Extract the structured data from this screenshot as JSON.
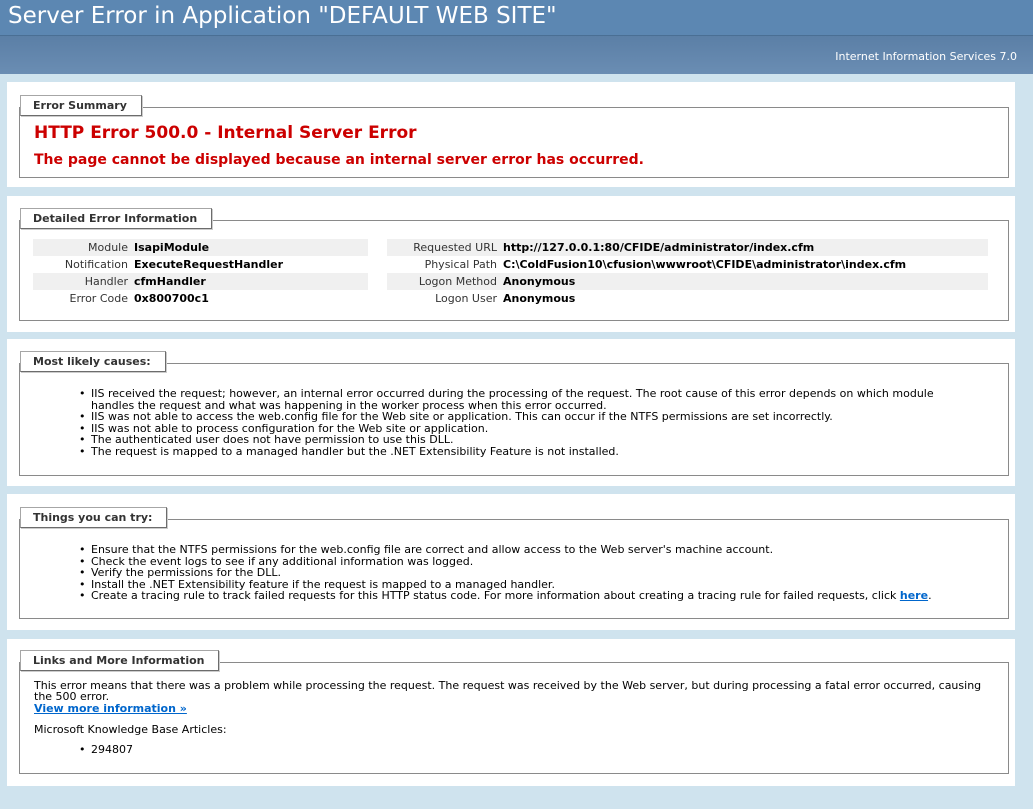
{
  "header": {
    "title": "Server Error in Application \"DEFAULT WEB SITE\"",
    "server": "Internet Information Services 7.0"
  },
  "summary": {
    "legend": "Error Summary",
    "title": "HTTP Error 500.0 - Internal Server Error",
    "message": "The page cannot be displayed because an internal server error has occurred."
  },
  "details": {
    "legend": "Detailed Error Information",
    "left": [
      {
        "label": "Module",
        "value": "IsapiModule"
      },
      {
        "label": "Notification",
        "value": "ExecuteRequestHandler"
      },
      {
        "label": "Handler",
        "value": "cfmHandler"
      },
      {
        "label": "Error Code",
        "value": "0x800700c1"
      }
    ],
    "right": [
      {
        "label": "Requested URL",
        "value": "http://127.0.0.1:80/CFIDE/administrator/index.cfm"
      },
      {
        "label": "Physical Path",
        "value": "C:\\ColdFusion10\\cfusion\\wwwroot\\CFIDE\\administrator\\index.cfm"
      },
      {
        "label": "Logon Method",
        "value": "Anonymous"
      },
      {
        "label": "Logon User",
        "value": "Anonymous"
      }
    ]
  },
  "causes": {
    "legend": "Most likely causes:",
    "items": [
      "IIS received the request; however, an internal error occurred during the processing of the request. The root cause of this error depends on which module handles the request and what was happening in the worker process when this error occurred.",
      "IIS was not able to access the web.config file for the Web site or application. This can occur if the NTFS permissions are set incorrectly.",
      "IIS was not able to process configuration for the Web site or application.",
      "The authenticated user does not have permission to use this DLL.",
      "The request is mapped to a managed handler but the .NET Extensibility Feature is not installed."
    ]
  },
  "try": {
    "legend": "Things you can try:",
    "items": [
      "Ensure that the NTFS permissions for the web.config file are correct and allow access to the Web server's machine account.",
      "Check the event logs to see if any additional information was logged.",
      "Verify the permissions for the DLL.",
      "Install the .NET Extensibility feature if the request is mapped to a managed handler."
    ],
    "last_item_text": "Create a tracing rule to track failed requests for this HTTP status code. For more information about creating a tracing rule for failed requests, click ",
    "last_item_link": "here",
    "last_item_end": "."
  },
  "links": {
    "legend": "Links and More Information",
    "text": "This error means that there was a problem while processing the request. The request was received by the Web server, but during processing a fatal error occurred, causing the 500 error.",
    "more_link": "View more information »",
    "kb_label": "Microsoft Knowledge Base Articles:",
    "kb_items": [
      "294807"
    ]
  }
}
